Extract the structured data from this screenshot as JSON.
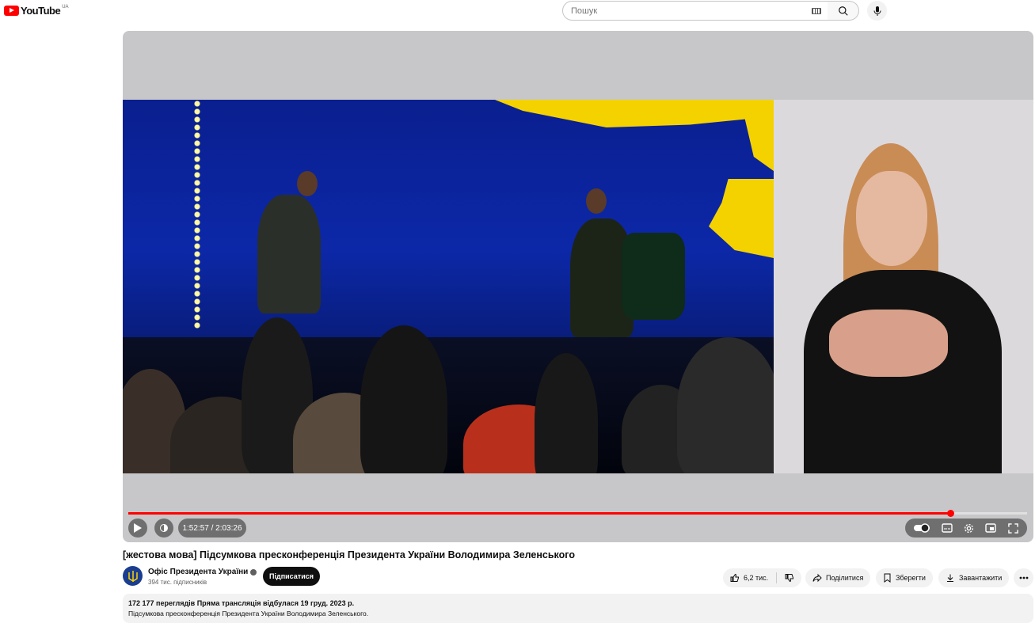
{
  "header": {
    "logo_text": "YouTube",
    "logo_region": "UA",
    "search_placeholder": "Пошук"
  },
  "player": {
    "current_time": "1:52:57",
    "duration": "2:03:26",
    "time_display": "1:52:57 / 2:03:26",
    "progress": 0.915
  },
  "video": {
    "title": "[жестова мова] Підсумкова пресконференція Президента України Володимира Зеленського"
  },
  "channel": {
    "name": "Офіс Президента України",
    "subscribers": "394 тис. підписників",
    "subscribe_label": "Підписатися"
  },
  "actions": {
    "like_count": "6,2 тис.",
    "share_label": "Поділитися",
    "save_label": "Зберегти",
    "download_label": "Завантажити"
  },
  "description": {
    "meta": "172 177 переглядів  Пряма трансляція відбулася 19 груд. 2023 р.",
    "text": "Підсумкова пресконференція Президента України Володимира Зеленського."
  },
  "colors": {
    "accent": "#ff0000",
    "subscribe_bg": "#0f0f0f",
    "pill_bg": "#f2f2f2"
  },
  "icons": [
    "youtube-logo-icon",
    "keyboard-icon",
    "search-icon",
    "mic-icon",
    "play-icon",
    "volume-icon",
    "autoplay-toggle-icon",
    "subtitles-icon",
    "settings-icon",
    "miniplayer-icon",
    "fullscreen-icon",
    "verified-icon",
    "like-icon",
    "dislike-icon",
    "share-icon",
    "save-icon",
    "download-icon",
    "more-icon"
  ]
}
